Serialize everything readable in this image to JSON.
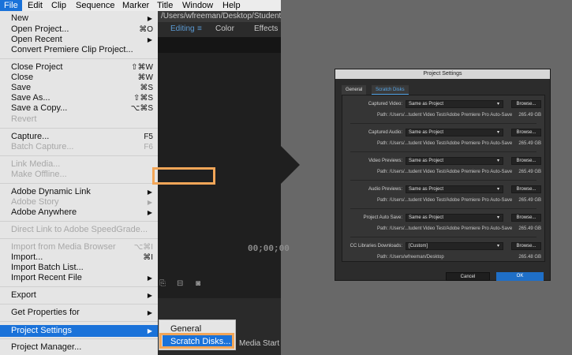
{
  "menubar": {
    "items": [
      "File",
      "Edit",
      "Clip",
      "Sequence",
      "Marker",
      "Title",
      "Window",
      "Help"
    ]
  },
  "file_menu": {
    "items": [
      {
        "label": "New",
        "shortcut": "",
        "submenu": true,
        "disabled": false
      },
      {
        "label": "Open Project...",
        "shortcut": "⌘O",
        "submenu": false,
        "disabled": false
      },
      {
        "label": "Open Recent",
        "shortcut": "",
        "submenu": true,
        "disabled": false
      },
      {
        "label": "Convert Premiere Clip Project...",
        "shortcut": "",
        "submenu": false,
        "disabled": false
      },
      {
        "label": "Close Project",
        "shortcut": "⇧⌘W",
        "submenu": false,
        "disabled": false
      },
      {
        "label": "Close",
        "shortcut": "⌘W",
        "submenu": false,
        "disabled": false
      },
      {
        "label": "Save",
        "shortcut": "⌘S",
        "submenu": false,
        "disabled": false
      },
      {
        "label": "Save As...",
        "shortcut": "⇧⌘S",
        "submenu": false,
        "disabled": false
      },
      {
        "label": "Save a Copy...",
        "shortcut": "⌥⌘S",
        "submenu": false,
        "disabled": false
      },
      {
        "label": "Revert",
        "shortcut": "",
        "submenu": false,
        "disabled": true
      },
      {
        "label": "Capture...",
        "shortcut": "F5",
        "submenu": false,
        "disabled": false
      },
      {
        "label": "Batch Capture...",
        "shortcut": "F6",
        "submenu": false,
        "disabled": true
      },
      {
        "label": "Link Media...",
        "shortcut": "",
        "submenu": false,
        "disabled": true
      },
      {
        "label": "Make Offline...",
        "shortcut": "",
        "submenu": false,
        "disabled": true
      },
      {
        "label": "Adobe Dynamic Link",
        "shortcut": "",
        "submenu": true,
        "disabled": false
      },
      {
        "label": "Adobe Story",
        "shortcut": "",
        "submenu": true,
        "disabled": true
      },
      {
        "label": "Adobe Anywhere",
        "shortcut": "",
        "submenu": true,
        "disabled": false
      },
      {
        "label": "Direct Link to Adobe SpeedGrade...",
        "shortcut": "",
        "submenu": false,
        "disabled": true
      },
      {
        "label": "Import from Media Browser",
        "shortcut": "⌥⌘I",
        "submenu": false,
        "disabled": true
      },
      {
        "label": "Import...",
        "shortcut": "⌘I",
        "submenu": false,
        "disabled": false
      },
      {
        "label": "Import Batch List...",
        "shortcut": "",
        "submenu": false,
        "disabled": false
      },
      {
        "label": "Import Recent File",
        "shortcut": "",
        "submenu": true,
        "disabled": false
      },
      {
        "label": "Export",
        "shortcut": "",
        "submenu": true,
        "disabled": false
      },
      {
        "label": "Get Properties for",
        "shortcut": "",
        "submenu": true,
        "disabled": false
      },
      {
        "label": "Project Settings",
        "shortcut": "",
        "submenu": true,
        "disabled": false,
        "highlighted": true
      },
      {
        "label": "Project Manager...",
        "shortcut": "",
        "submenu": false,
        "disabled": false
      }
    ]
  },
  "submenu": {
    "general": "General",
    "scratch_disks": "Scratch Disks..."
  },
  "app": {
    "path": "/Users/wfreeman/Desktop/Student Video",
    "tab_editing": "Editing",
    "tab_editing_icon": "≡",
    "tab_color": "Color",
    "tab_effects": "Effects",
    "timecode": "00;00;00",
    "media_start": "Media Start"
  },
  "dialog": {
    "title": "Project Settings",
    "tabs": [
      "General",
      "Scratch Disks"
    ],
    "rows": [
      {
        "label": "Captured Video:",
        "value": "Same as Project",
        "button": "Browse...",
        "path": "Path:  /Users/...tudent Video Test/Adobe Premiere Pro Auto-Save",
        "size": "265.49 GB"
      },
      {
        "label": "Captured Audio:",
        "value": "Same as Project",
        "button": "Browse...",
        "path": "Path:  /Users/...tudent Video Test/Adobe Premiere Pro Auto-Save",
        "size": "265.49 GB"
      },
      {
        "label": "Video Previews:",
        "value": "Same as Project",
        "button": "Browse...",
        "path": "Path:  /Users/...tudent Video Test/Adobe Premiere Pro Auto-Save",
        "size": "265.49 GB"
      },
      {
        "label": "Audio Previews:",
        "value": "Same as Project",
        "button": "Browse...",
        "path": "Path:  /Users/...tudent Video Test/Adobe Premiere Pro Auto-Save",
        "size": "265.49 GB"
      },
      {
        "label": "Project Auto Save:",
        "value": "Same as Project",
        "button": "Browse...",
        "path": "Path:  /Users/...tudent Video Test/Adobe Premiere Pro Auto-Save",
        "size": "265.49 GB"
      },
      {
        "label": "CC Libraries Downloads:",
        "value": "[Custom]",
        "button": "Browse...",
        "path": "Path:  /Users/wfreeman/Desktop",
        "size": "265.48 GB"
      }
    ],
    "cancel": "Cancel",
    "ok": "OK"
  },
  "colors": {
    "accent": "#1a72d9",
    "highlight_box": "#f2a658",
    "dialog_bg": "#2c2c2c"
  }
}
